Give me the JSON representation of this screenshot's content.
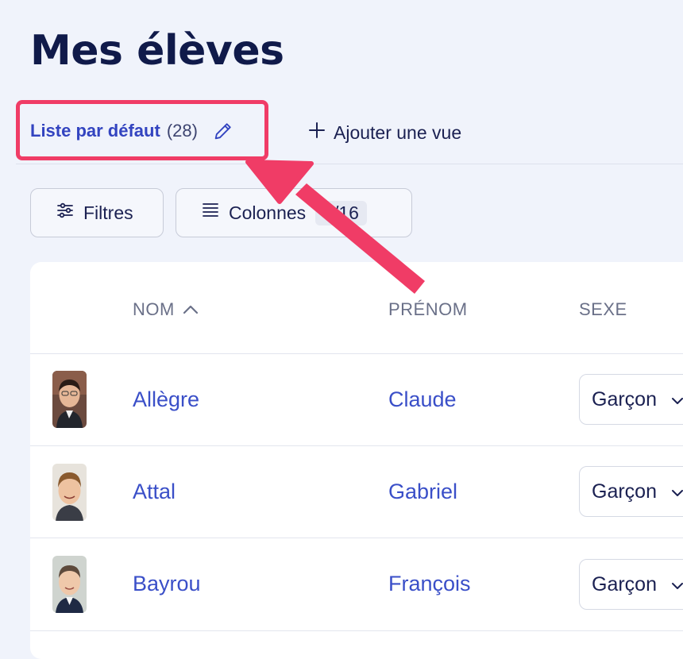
{
  "header": {
    "title": "Mes élèves"
  },
  "tabs": {
    "default_label": "Liste par défaut",
    "default_count": "(28)",
    "add_view_label": "Ajouter une vue"
  },
  "toolbar": {
    "filters_label": "Filtres",
    "columns_label": "Colonnes",
    "columns_count": "9/16"
  },
  "table": {
    "columns": [
      "NOM",
      "PRÉNOM",
      "SEXE"
    ],
    "sort": {
      "column": "NOM",
      "direction": "ascending"
    },
    "rows": [
      {
        "nom": "Allègre",
        "prenom": "Claude",
        "sexe": "Garçon"
      },
      {
        "nom": "Attal",
        "prenom": "Gabriel",
        "sexe": "Garçon"
      },
      {
        "nom": "Bayrou",
        "prenom": "François",
        "sexe": "Garçon"
      }
    ]
  },
  "colors": {
    "accent": "#3a4fc8",
    "highlight": "#f03c66",
    "title": "#101a4a",
    "background": "#f0f3fb"
  },
  "icons": [
    "pencil-icon",
    "plus-icon",
    "sliders-icon",
    "list-icon",
    "chevron-up-icon",
    "chevron-down-icon",
    "annotation-arrow"
  ]
}
